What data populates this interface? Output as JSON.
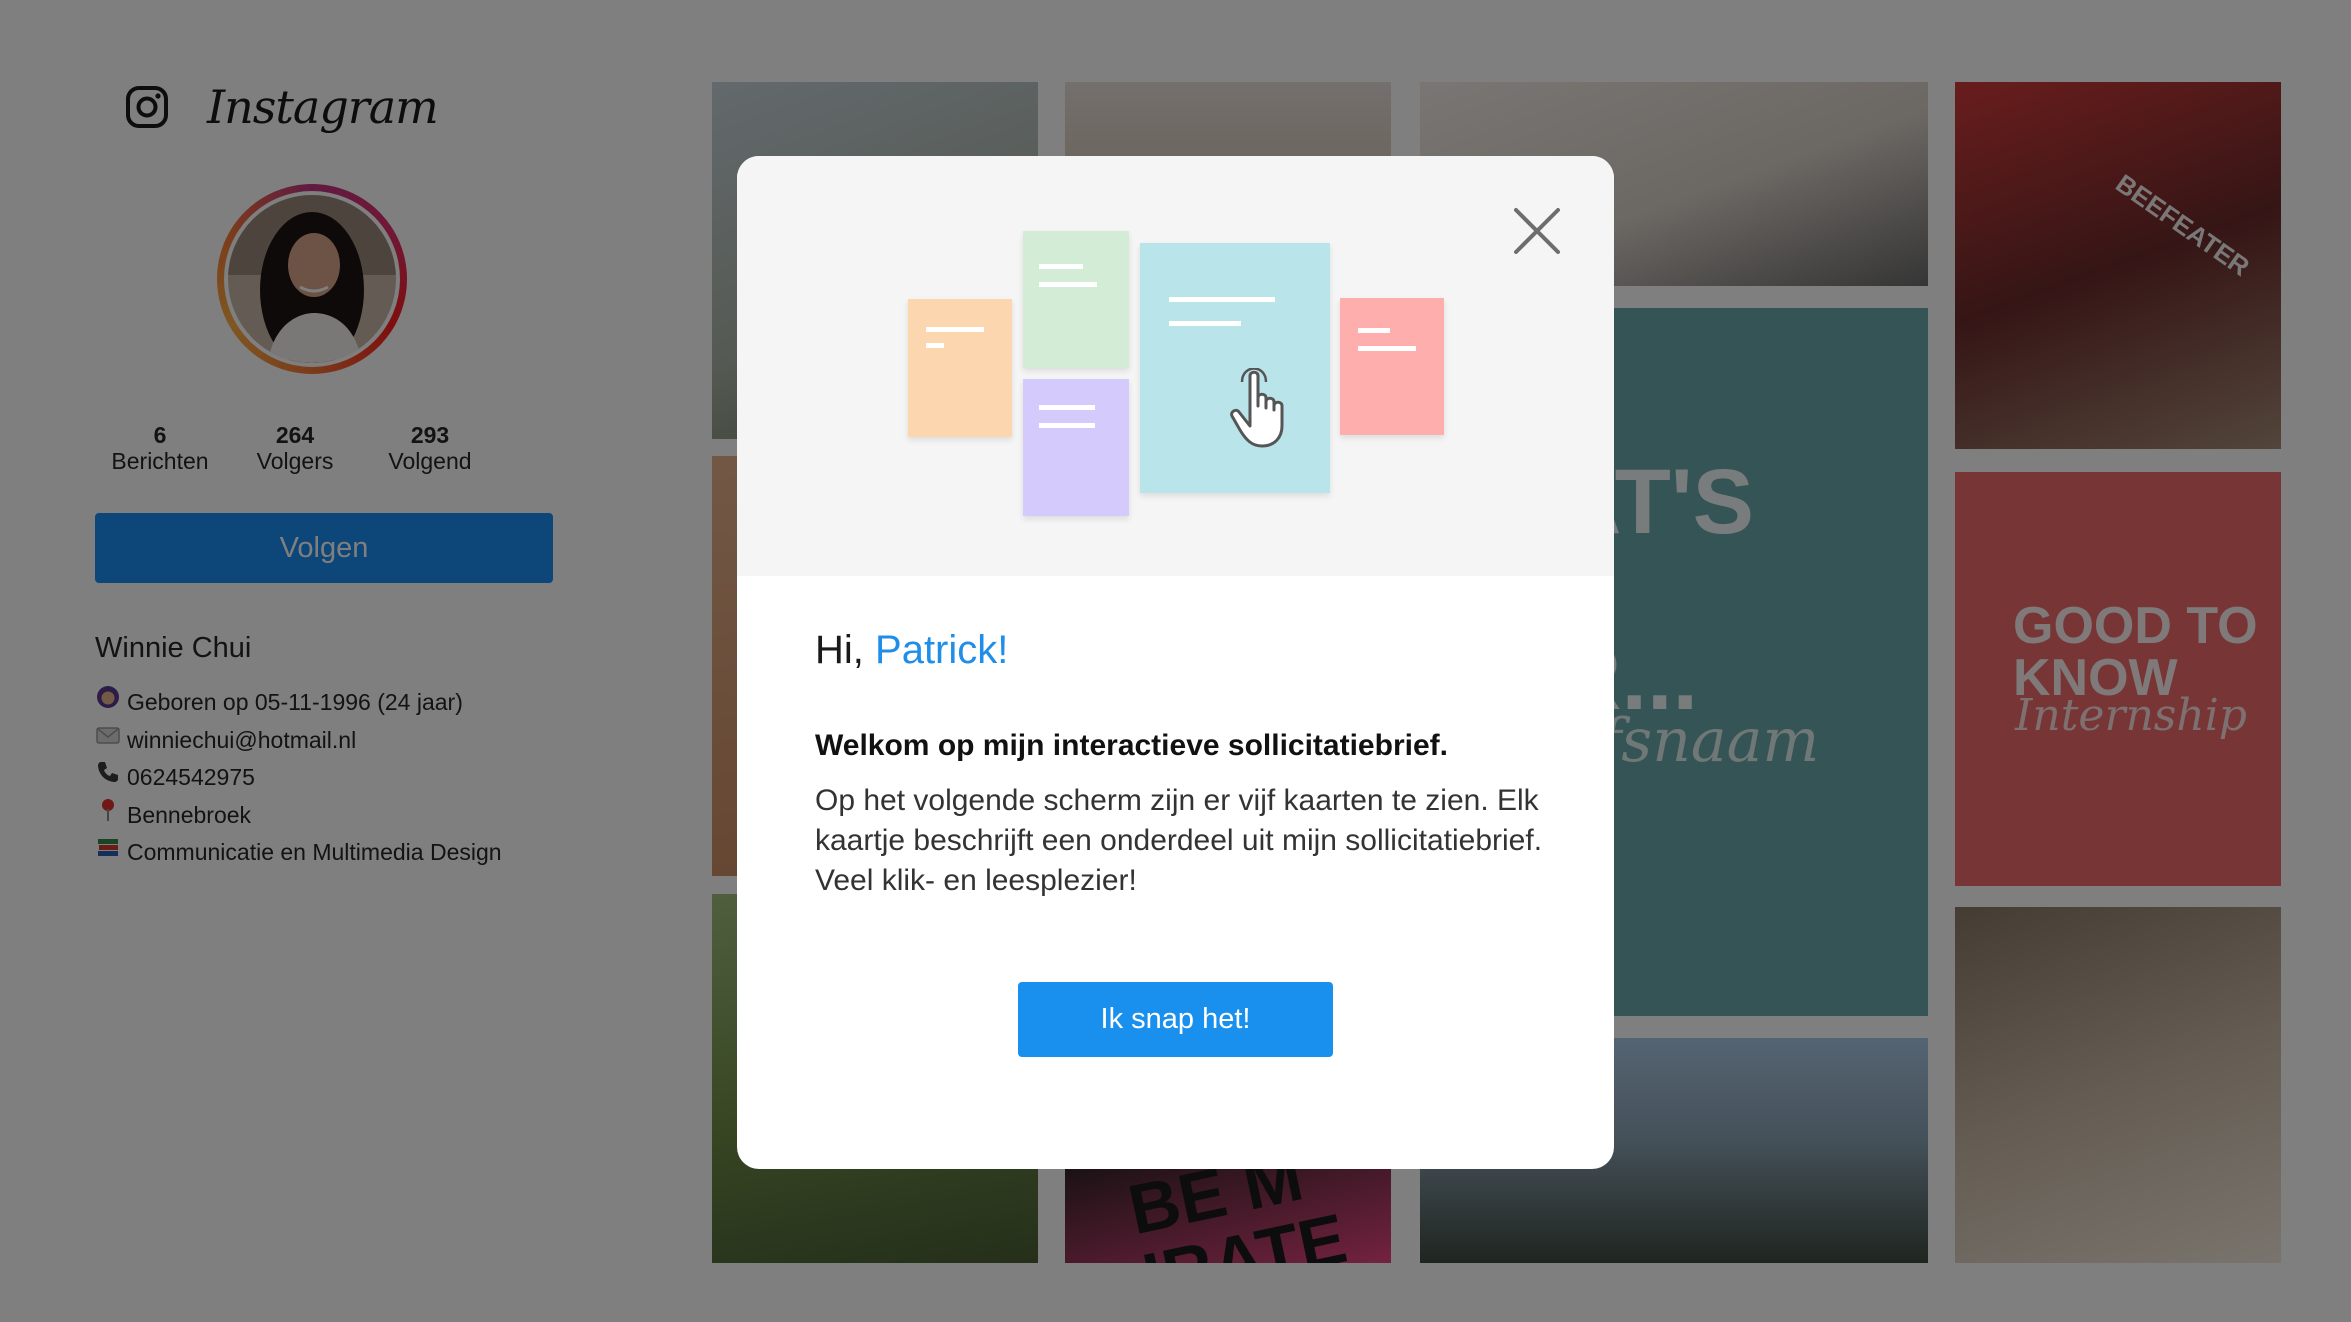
{
  "brand": {
    "wordmark": "Instagram",
    "icon": "instagram-camera-icon"
  },
  "profile": {
    "name": "Winnie Chui",
    "stats": [
      {
        "value": "6",
        "label": "Berichten"
      },
      {
        "value": "264",
        "label": "Volgers"
      },
      {
        "value": "293",
        "label": "Volgend"
      }
    ],
    "follow_label": "Volgen",
    "bio": [
      {
        "icon": "woman-emoji-icon",
        "text": "Geboren op 05-11-1996 (24 jaar)"
      },
      {
        "icon": "envelope-emoji-icon",
        "text": "winniechui@hotmail.nl"
      },
      {
        "icon": "telephone-emoji-icon",
        "text": "0624542975"
      },
      {
        "icon": "pin-emoji-icon",
        "text": "Bennebroek"
      },
      {
        "icon": "books-emoji-icon",
        "text": "Communicatie en Multimedia Design"
      }
    ]
  },
  "grid": {
    "tile_texts": {
      "whats_next": "AT'S\nT\nR...",
      "whats_next_script": "ifsnaam",
      "good_to_know": "GOOD TO\nKNOW",
      "good_to_know_script": "Internship",
      "beefeater": "BEEFEATER",
      "pirate": "BE M\nIRATE"
    }
  },
  "modal": {
    "greeting_prefix": "Hi,",
    "greeting_name": "Patrick!",
    "heading": "Welkom op mijn interactieve sollicitatiebrief.",
    "body": "Op het volgende scherm zijn er vijf kaarten te zien. Elk kaartje beschrijft een onderdeel uit mijn sollicitatiebrief. Veel klik- en leesplezier!",
    "cta_label": "Ik snap het!",
    "close_icon": "close-icon",
    "card_colors": [
      "#fbd6ae",
      "#d3ecd5",
      "#d4cafb",
      "#b9e4ea",
      "#feaeac"
    ]
  }
}
